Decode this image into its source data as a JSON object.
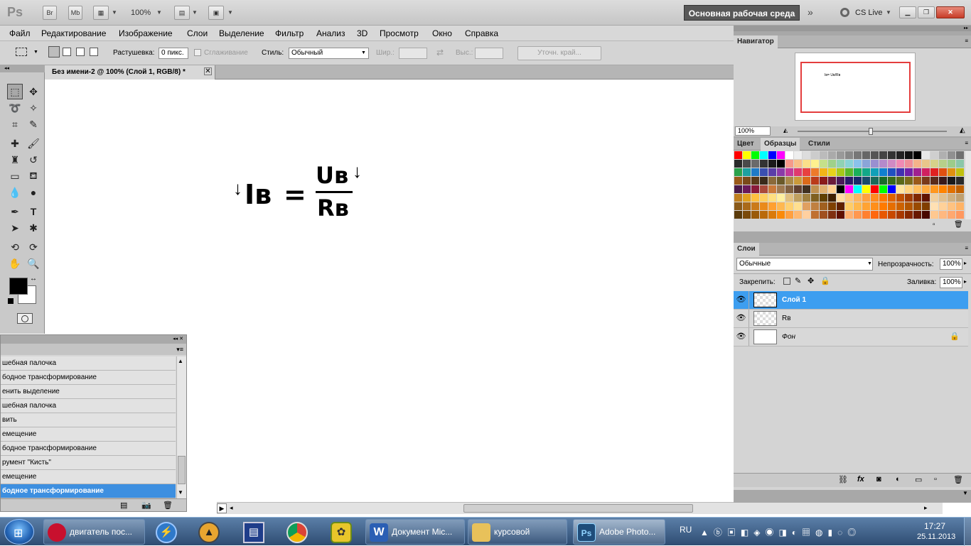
{
  "app": {
    "logo": "Ps",
    "zoom": "100%",
    "workspace": "Основная рабочая среда",
    "cslive": "CS Live"
  },
  "menu": [
    "Файл",
    "Редактирование",
    "Изображение",
    "Слои",
    "Выделение",
    "Фильтр",
    "Анализ",
    "3D",
    "Просмотр",
    "Окно",
    "Справка"
  ],
  "options": {
    "feather_label": "Растушевка:",
    "feather_value": "0 пикс.",
    "antialias_label": "Сглаживание",
    "style_label": "Стиль:",
    "style_value": "Обычный",
    "width_label": "Шир.:",
    "height_label": "Выс.:",
    "refine_label": "Уточн. край..."
  },
  "document": {
    "tab_title": "Без имени-2 @ 100% (Слой 1, RGB/8) *",
    "formula": {
      "lhs": "Iв",
      "eq": "=",
      "num": "Uв",
      "den": "Rв"
    }
  },
  "history": {
    "items": [
      "шебная палочка",
      "бодное трансформирование",
      "енить выделение",
      "шебная палочка",
      "вить",
      "емещение",
      "бодное трансформирование",
      "румент \"Кисть\"",
      "емещение",
      "бодное трансформирование"
    ],
    "selected_index": 9
  },
  "navigator": {
    "title": "Навигатор",
    "zoom": "100%",
    "preview_text": "Iв= Uв/Rв"
  },
  "swatches": {
    "tabs": [
      "Цвет",
      "Образцы",
      "Стили"
    ],
    "active": 1
  },
  "layers": {
    "title": "Слои",
    "blend": "Обычные",
    "opacity_label": "Непрозрачность:",
    "opacity": "100%",
    "lock_label": "Закрепить:",
    "fill_label": "Заливка:",
    "fill": "100%",
    "items": [
      {
        "name": "Слой 1",
        "selected": true,
        "white": false
      },
      {
        "name": "Rв",
        "selected": false,
        "white": false
      },
      {
        "name": "Фон",
        "selected": false,
        "white": true
      }
    ]
  },
  "taskbar": {
    "items": [
      {
        "label": "двигатель пос...",
        "color": "#c8102e"
      },
      {
        "label": "Документ Mic...",
        "color": "#2b5fb4"
      },
      {
        "label": "курсовой",
        "color": "#e8c15a"
      },
      {
        "label": "Adobe Photo...",
        "color": "#1f4d7a"
      }
    ],
    "lang": "RU",
    "time": "17:27",
    "date": "25.11.2013"
  },
  "colors": {
    "accent": "#3d9ef0",
    "ps_blue": "#0f3a6b"
  }
}
